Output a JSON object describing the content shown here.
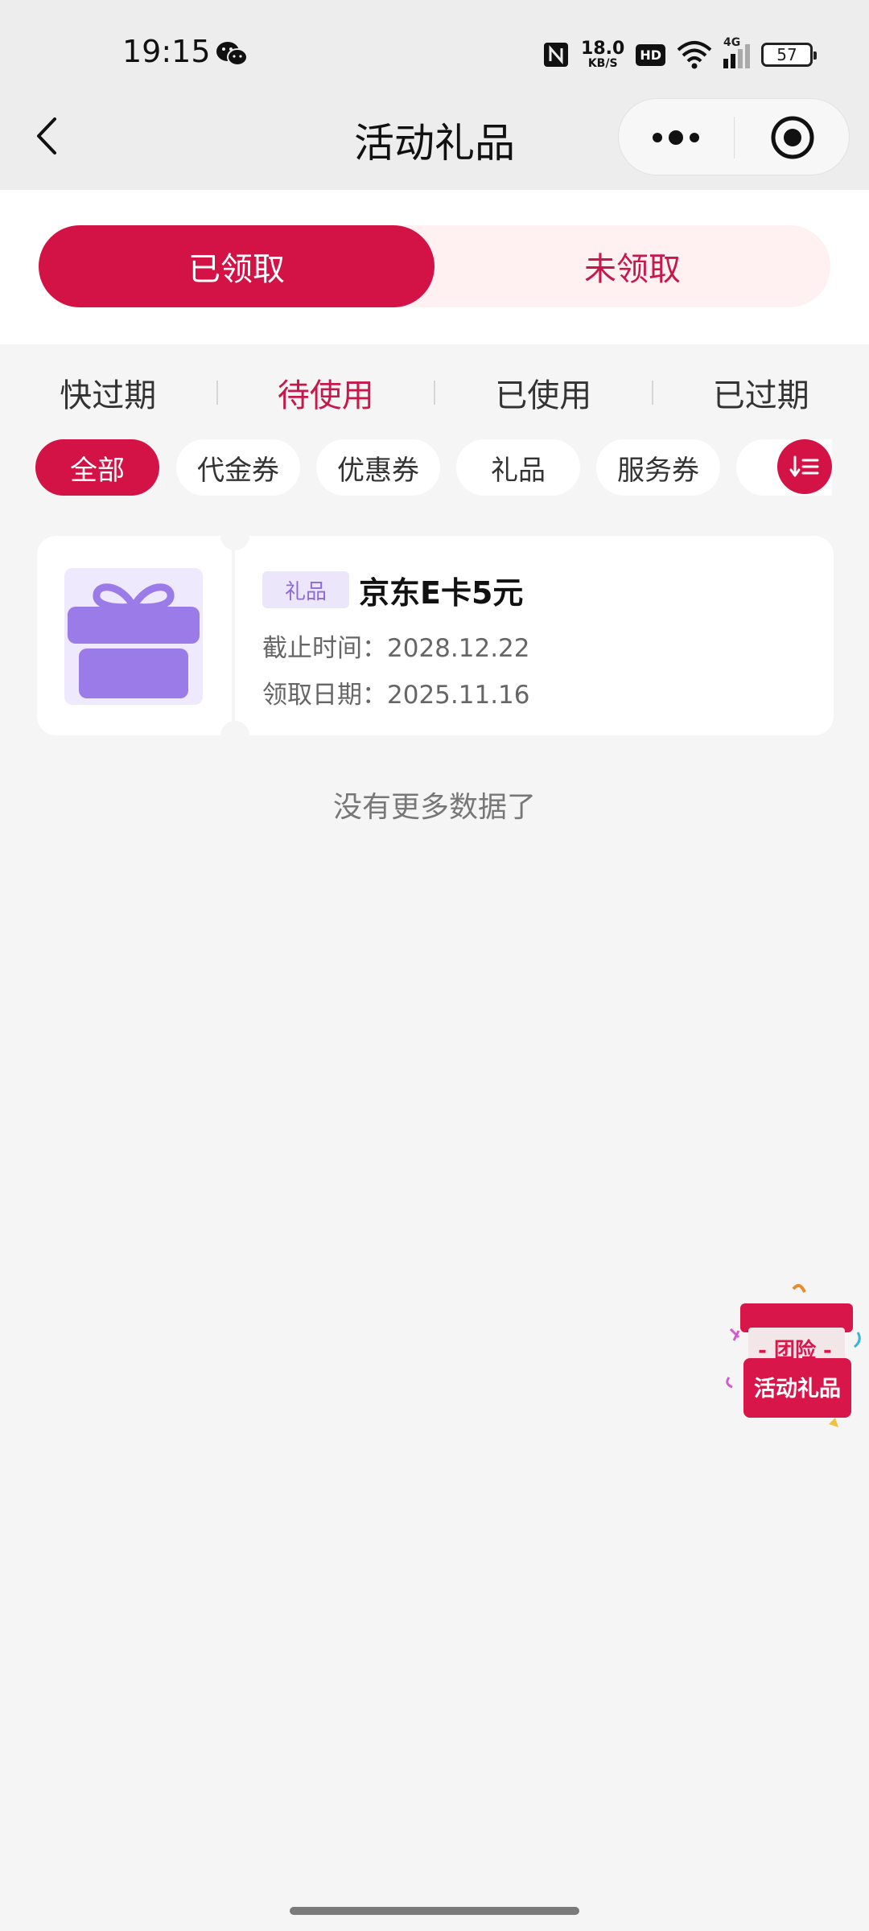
{
  "status_bar": {
    "time": "19:15",
    "net_speed_value": "18.0",
    "net_speed_unit": "KB/S",
    "hd": "HD",
    "signal_label": "4G",
    "battery": "57",
    "icons": [
      "wechat-icon",
      "nfc-icon",
      "wifi-icon",
      "signal-icon",
      "battery-icon"
    ]
  },
  "nav": {
    "title": "活动礼品",
    "icons": [
      "back-icon",
      "more-icon",
      "close-mini-program-icon"
    ]
  },
  "top_tabs": [
    {
      "label": "已领取",
      "active": true
    },
    {
      "label": "未领取",
      "active": false
    }
  ],
  "status_tabs": [
    {
      "label": "快过期",
      "active": false
    },
    {
      "label": "待使用",
      "active": true
    },
    {
      "label": "已使用",
      "active": false
    },
    {
      "label": "已过期",
      "active": false
    }
  ],
  "chips": [
    {
      "label": "全部",
      "active": true
    },
    {
      "label": "代金券",
      "active": false
    },
    {
      "label": "优惠券",
      "active": false
    },
    {
      "label": "礼品",
      "active": false
    },
    {
      "label": "服务券",
      "active": false
    }
  ],
  "gift_card": {
    "tag": "礼品",
    "name": "京东E卡5元",
    "deadline_label": "截止时间：",
    "deadline_value": "2028.12.22",
    "received_label": "领取日期：",
    "received_value": "2025.11.16",
    "icon": "gift-icon"
  },
  "no_more_text": "没有更多数据了",
  "floating_badge": {
    "top_text": "- 团险 -",
    "bottom_text": "活动礼品"
  },
  "colors": {
    "accent": "#d31245",
    "accent_light": "#fff0f2",
    "background": "#f5f5f5",
    "tag_bg": "#ece6fb",
    "tag_text": "#8e6ad8",
    "gift_purple": "#9b7be8"
  }
}
